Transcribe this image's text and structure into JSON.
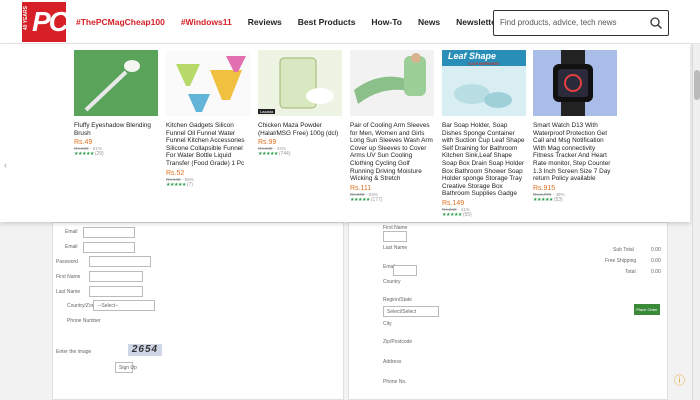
{
  "header": {
    "logo_years": "40 YEARS",
    "logo_text": "PC",
    "nav": [
      {
        "label": "#ThePCMagCheap100",
        "hash": true
      },
      {
        "label": "#Windows11",
        "hash": true
      },
      {
        "label": "Reviews",
        "hash": false
      },
      {
        "label": "Best Products",
        "hash": false
      },
      {
        "label": "How-To",
        "hash": false
      },
      {
        "label": "News",
        "hash": false
      },
      {
        "label": "Newsletters",
        "hash": false
      }
    ],
    "search_placeholder": "Find products, advice, tech news"
  },
  "popup": {
    "products": [
      {
        "title": "Fluffy Eyeshadow Blending Brush",
        "price": "Rs.49",
        "mrp": "Rs.103",
        "discount": "- 51%",
        "stars": "★★★★★",
        "count": "(29)"
      },
      {
        "title": "Kitchen Gadgets Silicon Funnel Oil Funnel Water Funnel Kitchen Accessories Silicone Collapsible Funnel For Water Bottle Liquid Transfer (Food Grade) 1 Pc",
        "price": "Rs.52",
        "mrp": "Rs.148",
        "discount": "- 65%",
        "stars": "★★★★★",
        "count": "(7)"
      },
      {
        "title": "Chicken Maza Powder (Halal/MSG Free) 100g (dcl)",
        "price": "Rs.99",
        "mrp": "Rs.149",
        "discount": "- 34%",
        "stars": "★★★★★",
        "count": "(744)",
        "badge": "Lazada"
      },
      {
        "title": "Pair of Cooling Arm Sleeves for Men, Women and Girls Long Sun Sleeves Wash Arm Cover up Sleeves to Cover Arms UV Sun Cooling Clothing Cycling Golf Running Driving Moisture Wicking & Stretch",
        "price": "Rs.111",
        "mrp": "Rs.300",
        "discount": "- 63%",
        "stars": "★★★★★",
        "count": "(177)"
      },
      {
        "title": "Bar Soap Holder, Soap Dishes Sponge Container with Suction Cup Leaf Shape Self Draining for Bathroom Kitchen Sink,Leaf Shape Soap Box Drain Soap Holder Box Bathroom Shower Soap Holder sponge Storage Tray Creative Storage Box Bathroom Supplies Gadge",
        "price": "Rs.149",
        "mrp": "Rs.249",
        "discount": "- 41%",
        "stars": "★★★★★",
        "count": "(55)",
        "img_label": "Leaf Shape",
        "img_sublabel": "SOAP DISPENSER"
      },
      {
        "title": "Smart Watch D13 With Waterproof Protection Get Call and Msg Notification With Mag connectivity Fitness Tracker And Heart Rate monitor, Step Counter 1.3 Inch Screen Size 7 Day return Policy available",
        "price": "Rs.915",
        "mrp": "Rs.1,779",
        "discount": "- 49%",
        "stars": "★★★★★",
        "count": "(53)"
      }
    ]
  },
  "background": {
    "left_form_labels": [
      "Email",
      "Email",
      "Password",
      "First Name",
      "Last Name",
      "Country/Zone",
      "Phone Number",
      "Enter the image"
    ],
    "country_select": "--Select--",
    "captcha": "2654",
    "submit": "Sign Up",
    "right_labels": [
      "First Name",
      "Last Name",
      "Email",
      "Country",
      "Region/State",
      "City",
      "Zip/Postcode",
      "Address",
      "Phone No."
    ],
    "region_value": "Select/Select",
    "summary": [
      "Sub Total",
      "Free Shipping",
      "Total"
    ],
    "summary_values": [
      "0.00",
      "0.00",
      "0.00"
    ],
    "place_order": "Place Order"
  }
}
